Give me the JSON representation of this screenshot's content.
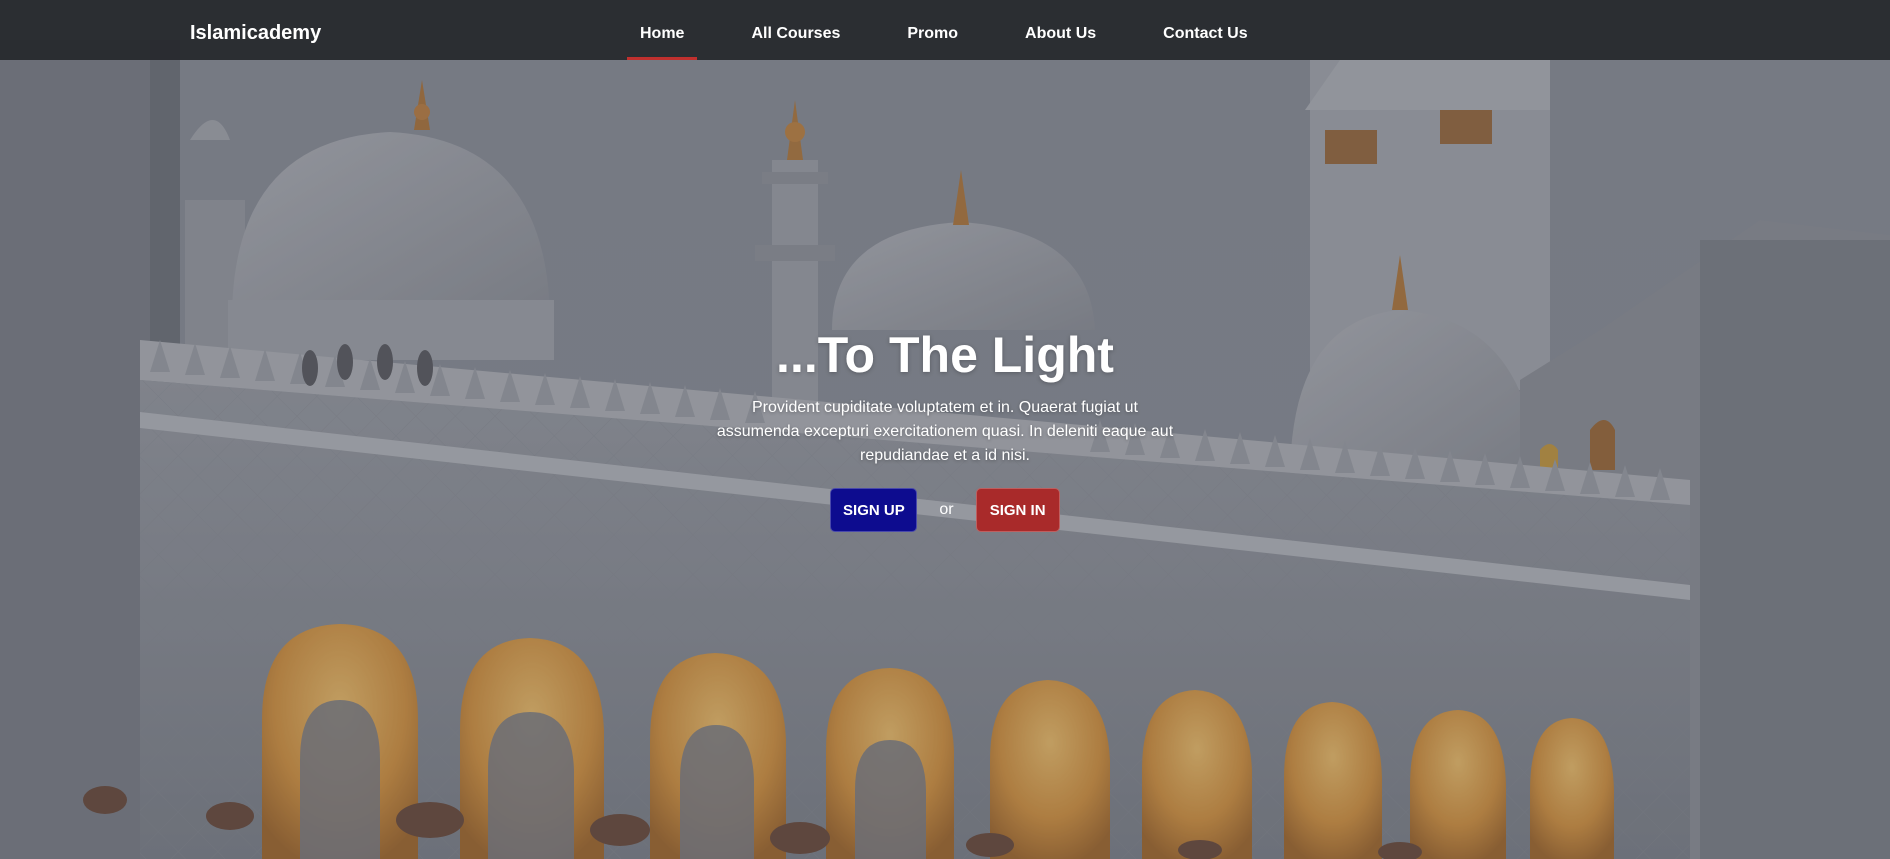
{
  "navbar": {
    "brand": "Islamicademy",
    "items": [
      {
        "label": "Home",
        "active": true
      },
      {
        "label": "All Courses",
        "active": false
      },
      {
        "label": "Promo",
        "active": false
      },
      {
        "label": "About Us",
        "active": false
      },
      {
        "label": "Contact Us",
        "active": false
      }
    ],
    "active_indicator_color": "#c0302e"
  },
  "hero": {
    "title": "...To The Light",
    "text": "Provident cupiditate voluptatem et in. Quaerat fugiat ut assumenda excepturi exercitationem quasi. In deleniti eaque aut repudiandae et a id nisi.",
    "signup_label": "SIGN UP",
    "or_label": "or",
    "signin_label": "SIGN IN",
    "signup_color": "#0d0c8f",
    "signin_color": "#a92a2a"
  }
}
